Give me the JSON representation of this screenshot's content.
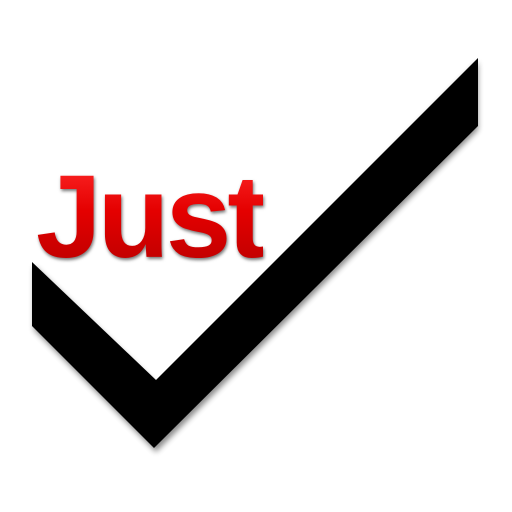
{
  "logo": {
    "word": "Just",
    "word_color": "#e10000",
    "mark_icon": "checkmark-icon",
    "mark_color": "#000000",
    "background": "#ffffff"
  }
}
